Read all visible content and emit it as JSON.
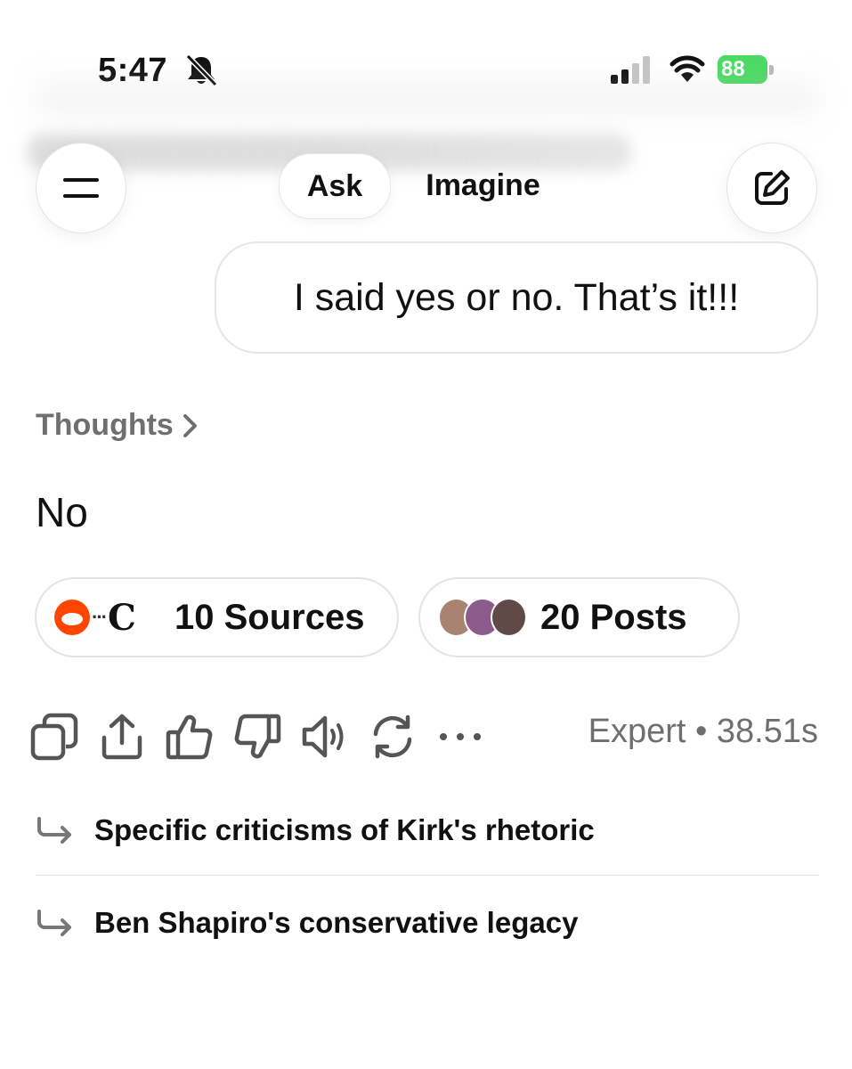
{
  "status_bar": {
    "time": "5:47",
    "battery": "88",
    "icons": [
      "bell-slash-icon",
      "cellular-signal-icon",
      "wifi-icon",
      "battery-charging-icon"
    ],
    "battery_color": "#4cd964"
  },
  "header": {
    "menu_icon": "menu-icon",
    "tabs": [
      {
        "label": "Ask",
        "active": true
      },
      {
        "label": "Imagine",
        "active": false
      }
    ],
    "edit_icon": "new-chat-icon"
  },
  "conversation": {
    "user_message": "I said yes or no. That’s it!!!",
    "thoughts_label": "Thoughts",
    "answer": "No",
    "sources": {
      "label": "10 Sources",
      "icons": [
        "reddit-icon",
        "news-icon"
      ]
    },
    "posts": {
      "label": "20 Posts",
      "avatar_colors": [
        "#a88372",
        "#8d5a8c",
        "#5f4a48"
      ]
    },
    "actions": [
      "copy-icon",
      "share-icon",
      "thumbs-up-icon",
      "thumbs-down-icon",
      "read-aloud-icon",
      "regenerate-icon",
      "more-icon"
    ],
    "meta": "Expert • 38.51s",
    "followups": [
      "Specific criticisms of Kirk's rhetoric",
      "Ben Shapiro's conservative legacy"
    ]
  },
  "colors": {
    "text": "#111111",
    "muted": "#6f6f6f",
    "border": "#e4e4e4",
    "reddit": "#ff4500"
  }
}
